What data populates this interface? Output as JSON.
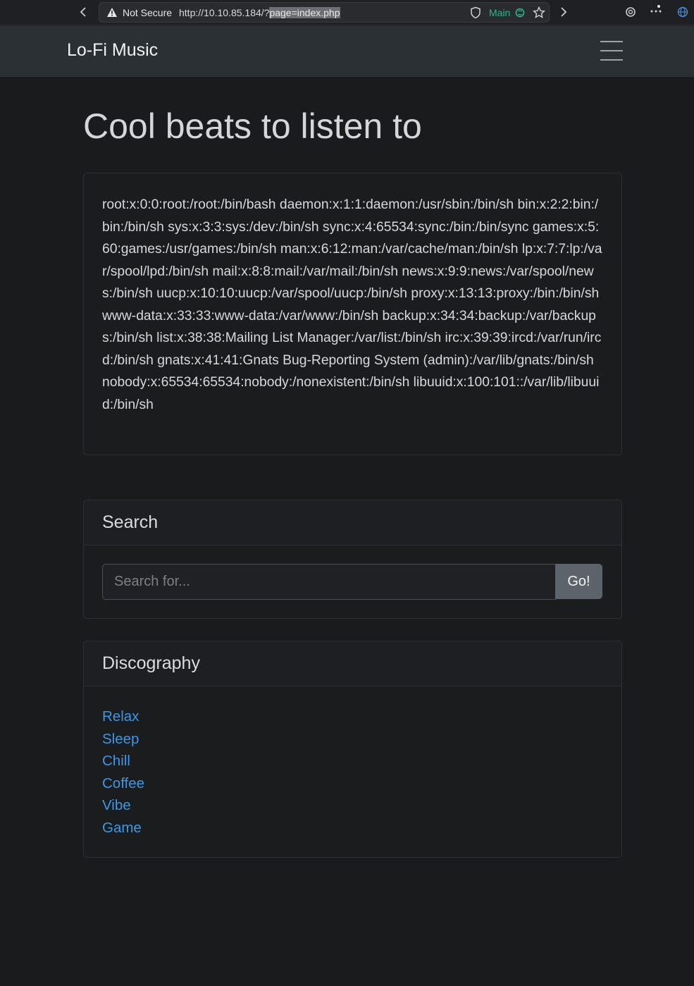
{
  "browser": {
    "security_label": "Not Secure",
    "url_base": "http://10.10.85.184/?",
    "url_selected": "page=index.php",
    "container_label": "Main",
    "accent_color": "#27b88c"
  },
  "navbar": {
    "brand": "Lo-Fi Music",
    "toggler_icon": "hamburger-icon"
  },
  "main": {
    "title": "Cool beats to listen to",
    "file_contents": "root:x:0:0:root:/root:/bin/bash daemon:x:1:1:daemon:/usr/sbin:/bin/sh bin:x:2:2:bin:/bin:/bin/sh sys:x:3:3:sys:/dev:/bin/sh sync:x:4:65534:sync:/bin:/bin/sync games:x:5:60:games:/usr/games:/bin/sh man:x:6:12:man:/var/cache/man:/bin/sh lp:x:7:7:lp:/var/spool/lpd:/bin/sh mail:x:8:8:mail:/var/mail:/bin/sh news:x:9:9:news:/var/spool/news:/bin/sh uucp:x:10:10:uucp:/var/spool/uucp:/bin/sh proxy:x:13:13:proxy:/bin:/bin/sh www-data:x:33:33:www-data:/var/www:/bin/sh backup:x:34:34:backup:/var/backups:/bin/sh list:x:38:38:Mailing List Manager:/var/list:/bin/sh irc:x:39:39:ircd:/var/run/ircd:/bin/sh gnats:x:41:41:Gnats Bug-Reporting System (admin):/var/lib/gnats:/bin/sh nobody:x:65534:65534:nobody:/nonexistent:/bin/sh libuuid:x:100:101::/var/lib/libuuid:/bin/sh"
  },
  "search": {
    "header": "Search",
    "placeholder": "Search for...",
    "value": "",
    "button_label": "Go!"
  },
  "discography": {
    "header": "Discography",
    "items": [
      "Relax",
      "Sleep",
      "Chill",
      "Coffee",
      "Vibe",
      "Game"
    ],
    "link_color": "#3d97e6"
  }
}
